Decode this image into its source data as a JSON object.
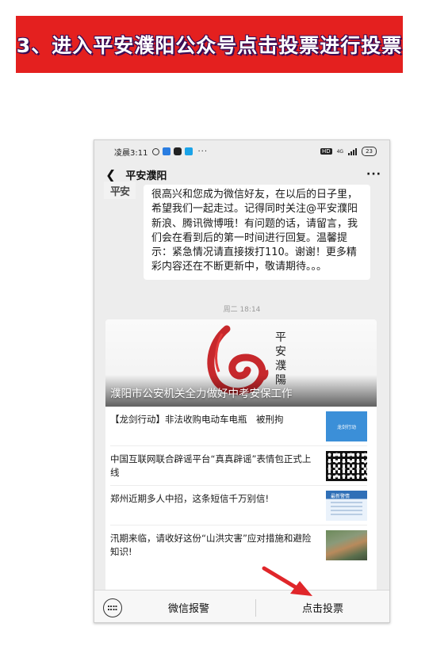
{
  "banner": {
    "text": "3、进入平安濮阳公众号点击投票进行投票"
  },
  "status_bar": {
    "time": "凌晨3:11",
    "more": "···",
    "hd": "HD",
    "signal": "4G",
    "battery": "23"
  },
  "nav": {
    "title": "平安濮阳",
    "more": "···"
  },
  "avatar_text": "平安",
  "welcome_message": "很高兴和您成为微信好友，在以后的日子里，希望我们一起走过。记得同时关注@平安濮阳 新浪、腾讯微博哦！有问题的话，请留言，我们会在看到后的第一时间进行回复。温馨提示：紧急情况请直接拨打110。谢谢！更多精彩内容还在不断更新中，敬请期待。。。",
  "timestamp": "周二 18:14",
  "card": {
    "cover_title": "濮阳市公安机关全力做好中考安保工作",
    "cover_calligraphy": "平安濮陽",
    "articles": [
      {
        "title": "【龙剑行动】非法收购电动车电瓶　被刑拘",
        "thumb_text": "龙剑行动"
      },
      {
        "title": "中国互联网联合辟谣平台“真真辟谣”表情包正式上线",
        "thumb_text": ""
      },
      {
        "title": "郑州近期多人中招，这条短信千万别信!",
        "thumb_text": "最新警情"
      },
      {
        "title": "汛期来临，请收好这份“山洪灾害”应对措施和避险知识!",
        "thumb_text": ""
      }
    ]
  },
  "bottom_menu": {
    "left": "微信报警",
    "right": "点击投票"
  },
  "colors": {
    "banner_red": "#e4201f",
    "arrow_red": "#e0262a",
    "logo_red": "#c7282c"
  }
}
